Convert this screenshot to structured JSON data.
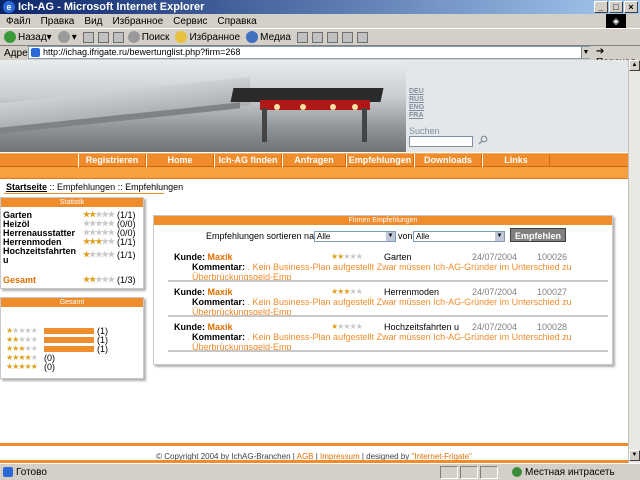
{
  "window": {
    "title": "Ich-AG - Microsoft Internet Explorer"
  },
  "menu": [
    "Файл",
    "Правка",
    "Вид",
    "Избранное",
    "Сервис",
    "Справка"
  ],
  "toolbar": {
    "back": "Назад",
    "search": "Поиск",
    "favorites": "Избранное",
    "media": "Медиа"
  },
  "address": {
    "label": "Адрес:",
    "url": "http://ichag.ifrigate.ru/bewertunglist.php?firm=268",
    "go": "Переход"
  },
  "lang": [
    "DEU",
    "RUS",
    "ENG",
    "FRA"
  ],
  "search": {
    "label": "Suchen"
  },
  "nav": [
    "Registrieren",
    "Home",
    "Ich-AG finden",
    "Anfragen",
    "Empfehlungen",
    "Downloads",
    "Links"
  ],
  "breadcrumb": {
    "home": "Startseite",
    "rest": " :: Empfehlungen :: Empfehlungen"
  },
  "statistik": {
    "title": "Statistik",
    "rows": [
      {
        "label": "Garten",
        "count": "(1/1)",
        "stars": 2
      },
      {
        "label": "Heizöl",
        "count": "(0/0)",
        "stars": 0
      },
      {
        "label": "Herrenausstatter",
        "count": "(0/0)",
        "stars": 0
      },
      {
        "label": "Herrenmoden",
        "count": "(1/1)",
        "stars": 3
      },
      {
        "label": "Hochzeitsfahrten",
        "label2": "u",
        "count": "(1/1)",
        "stars": 1
      }
    ],
    "total": {
      "label": "Gesamt",
      "count": "(1/3)",
      "stars": 2
    }
  },
  "gesamt": {
    "title": "Gesamt",
    "bars": [
      {
        "stars": 1,
        "count": "(1)",
        "fill": 1
      },
      {
        "stars": 2,
        "count": "(1)",
        "fill": 1
      },
      {
        "stars": 3,
        "count": "(1)",
        "fill": 1
      },
      {
        "stars": 4,
        "count": "(0)",
        "fill": 0
      },
      {
        "stars": 5,
        "count": "(0)",
        "fill": 0
      }
    ]
  },
  "panel": {
    "title": "Firmen Empfehlungen",
    "sort_label": "Empfehlungen sortieren nach:",
    "sort_value": "Alle",
    "von_label": "von:",
    "von_value": "Alle",
    "button": "Empfehlen",
    "entries": [
      {
        "kunde_label": "Kunde:",
        "name": "Maxik",
        "stars": 2,
        "category": "Garten",
        "date": "24/07/2004",
        "id": "100026",
        "komm_label": "Kommentar:",
        "text1": " . Kein Business-Plan aufgestellt Zwar müssen Ich-AG-Gründer im Unterschied zu",
        "text2": "Überbrückungsgeld-Emp"
      },
      {
        "kunde_label": "Kunde:",
        "name": "Maxik",
        "stars": 3,
        "category": "Herrenmoden",
        "date": "24/07/2004",
        "id": "100027",
        "komm_label": "Kommentar:",
        "text1": " . Kein Business-Plan aufgestellt Zwar müssen Ich-AG-Gründer im Unterschied zu",
        "text2": "Überbrückungsgeld-Emp"
      },
      {
        "kunde_label": "Kunde:",
        "name": "Maxik",
        "stars": 1,
        "category": "Hochzeitsfahrten u",
        "date": "24/07/2004",
        "id": "100028",
        "komm_label": "Kommentar:",
        "text1": " . Kein Business-Plan aufgestellt Zwar müssen Ich-AG-Gründer im Unterschied zu",
        "text2": "Überbrückungsgeld-Emp"
      }
    ]
  },
  "footer": {
    "copyright": "© Copyright 2004 by IchAG-Branchen | ",
    "agb": "AGB",
    "sep1": " | ",
    "impressum": "Impressum",
    "sep2": " | designed by ",
    "designer": "\"Internet-Frigate\""
  },
  "status": {
    "text": "Готово",
    "zone": "Местная интрасеть"
  },
  "colors": {
    "accent": "#f08c2c",
    "link": "#e07000",
    "star": "#e0a020"
  }
}
